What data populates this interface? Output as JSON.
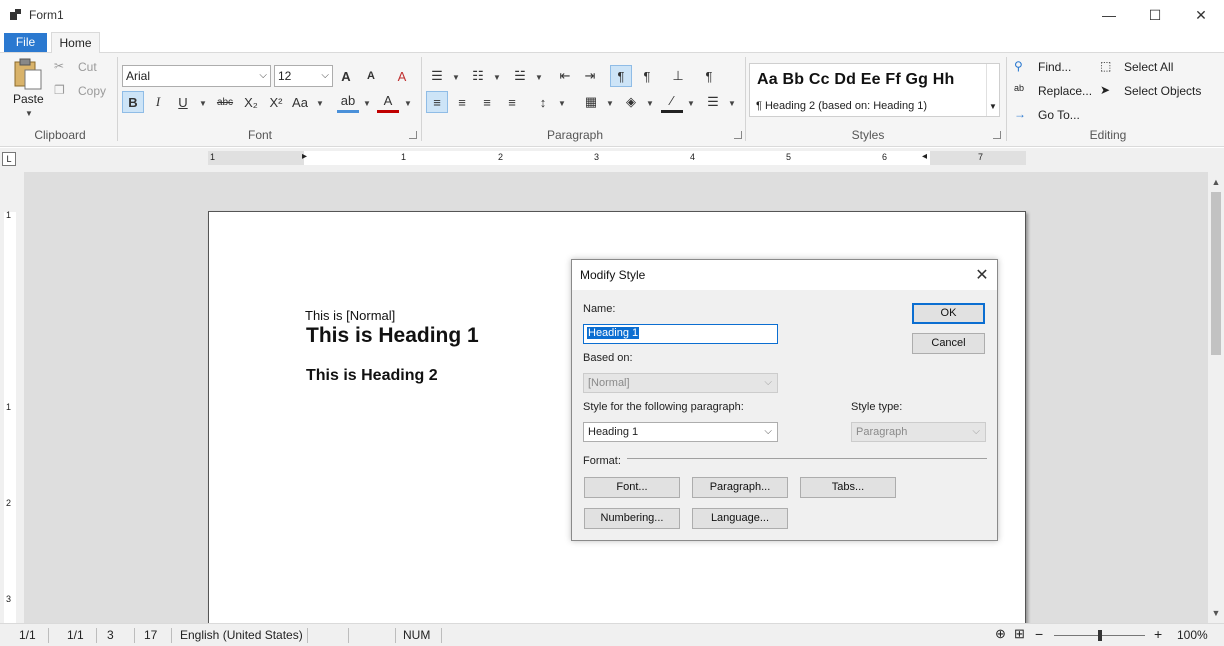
{
  "window": {
    "title": "Form1",
    "minimize": "—",
    "maximize": "☐",
    "close": "✕"
  },
  "tabs": {
    "file": "File",
    "home": "Home"
  },
  "ribbon": {
    "clipboard": {
      "label": "Clipboard",
      "paste": "Paste",
      "cut": "Cut",
      "copy": "Copy"
    },
    "font": {
      "label": "Font",
      "family": "Arial",
      "size": "12",
      "bold": "B",
      "italic": "I",
      "underline": "U",
      "strike": "abc",
      "subscript": "X₂",
      "superscript": "X²",
      "change_case": "Aa",
      "grow": "A",
      "shrink": "A"
    },
    "paragraph": {
      "label": "Paragraph"
    },
    "styles": {
      "label": "Styles",
      "sample": "Aa Bb Cc Dd Ee Ff Gg Hh",
      "current": "¶ Heading 2    (based on: Heading 1)"
    },
    "editing": {
      "label": "Editing",
      "find": "Find...",
      "replace": "Replace...",
      "goto": "Go To...",
      "select_all": "Select All",
      "select_objects": "Select Objects"
    }
  },
  "document": {
    "line_normal": "This is [Normal]",
    "line_h1": "This is Heading 1",
    "line_h2": "This is Heading 2"
  },
  "dialog": {
    "title": "Modify Style",
    "name_label": "Name:",
    "name_value": "Heading 1",
    "based_on_label": "Based on:",
    "based_on_value": "[Normal]",
    "following_label": "Style for the following paragraph:",
    "following_value": "Heading 1",
    "type_label": "Style type:",
    "type_value": "Paragraph",
    "format_label": "Format:",
    "ok": "OK",
    "cancel": "Cancel",
    "font_btn": "Font...",
    "paragraph_btn": "Paragraph...",
    "tabs_btn": "Tabs...",
    "numbering_btn": "Numbering...",
    "language_btn": "Language..."
  },
  "status": {
    "page": "1/1",
    "section": "1/1",
    "line": "3",
    "column": "17",
    "language": "English (United States)",
    "num": "NUM",
    "zoom": "100%",
    "zoom_minus": "−",
    "zoom_plus": "+",
    "zoom_fraction": 0.5
  },
  "ruler": {
    "h_labels": [
      "1",
      "1",
      "2",
      "3",
      "4",
      "5",
      "6",
      "7"
    ],
    "v_labels": [
      "1",
      "1",
      "2",
      "3"
    ]
  },
  "colors": {
    "accent": "#2b79d0",
    "selection": "#0b6ed1",
    "active_button": "#cde4f7"
  }
}
